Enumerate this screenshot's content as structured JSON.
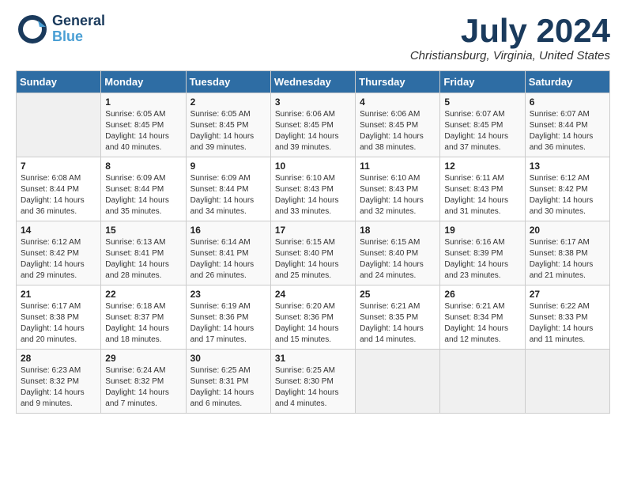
{
  "logo": {
    "line1": "General",
    "line2": "Blue"
  },
  "title": "July 2024",
  "location": "Christiansburg, Virginia, United States",
  "days_header": [
    "Sunday",
    "Monday",
    "Tuesday",
    "Wednesday",
    "Thursday",
    "Friday",
    "Saturday"
  ],
  "weeks": [
    [
      {
        "day": "",
        "sunrise": "",
        "sunset": "",
        "daylight": ""
      },
      {
        "day": "1",
        "sunrise": "Sunrise: 6:05 AM",
        "sunset": "Sunset: 8:45 PM",
        "daylight": "Daylight: 14 hours and 40 minutes."
      },
      {
        "day": "2",
        "sunrise": "Sunrise: 6:05 AM",
        "sunset": "Sunset: 8:45 PM",
        "daylight": "Daylight: 14 hours and 39 minutes."
      },
      {
        "day": "3",
        "sunrise": "Sunrise: 6:06 AM",
        "sunset": "Sunset: 8:45 PM",
        "daylight": "Daylight: 14 hours and 39 minutes."
      },
      {
        "day": "4",
        "sunrise": "Sunrise: 6:06 AM",
        "sunset": "Sunset: 8:45 PM",
        "daylight": "Daylight: 14 hours and 38 minutes."
      },
      {
        "day": "5",
        "sunrise": "Sunrise: 6:07 AM",
        "sunset": "Sunset: 8:45 PM",
        "daylight": "Daylight: 14 hours and 37 minutes."
      },
      {
        "day": "6",
        "sunrise": "Sunrise: 6:07 AM",
        "sunset": "Sunset: 8:44 PM",
        "daylight": "Daylight: 14 hours and 36 minutes."
      }
    ],
    [
      {
        "day": "7",
        "sunrise": "Sunrise: 6:08 AM",
        "sunset": "Sunset: 8:44 PM",
        "daylight": "Daylight: 14 hours and 36 minutes."
      },
      {
        "day": "8",
        "sunrise": "Sunrise: 6:09 AM",
        "sunset": "Sunset: 8:44 PM",
        "daylight": "Daylight: 14 hours and 35 minutes."
      },
      {
        "day": "9",
        "sunrise": "Sunrise: 6:09 AM",
        "sunset": "Sunset: 8:44 PM",
        "daylight": "Daylight: 14 hours and 34 minutes."
      },
      {
        "day": "10",
        "sunrise": "Sunrise: 6:10 AM",
        "sunset": "Sunset: 8:43 PM",
        "daylight": "Daylight: 14 hours and 33 minutes."
      },
      {
        "day": "11",
        "sunrise": "Sunrise: 6:10 AM",
        "sunset": "Sunset: 8:43 PM",
        "daylight": "Daylight: 14 hours and 32 minutes."
      },
      {
        "day": "12",
        "sunrise": "Sunrise: 6:11 AM",
        "sunset": "Sunset: 8:43 PM",
        "daylight": "Daylight: 14 hours and 31 minutes."
      },
      {
        "day": "13",
        "sunrise": "Sunrise: 6:12 AM",
        "sunset": "Sunset: 8:42 PM",
        "daylight": "Daylight: 14 hours and 30 minutes."
      }
    ],
    [
      {
        "day": "14",
        "sunrise": "Sunrise: 6:12 AM",
        "sunset": "Sunset: 8:42 PM",
        "daylight": "Daylight: 14 hours and 29 minutes."
      },
      {
        "day": "15",
        "sunrise": "Sunrise: 6:13 AM",
        "sunset": "Sunset: 8:41 PM",
        "daylight": "Daylight: 14 hours and 28 minutes."
      },
      {
        "day": "16",
        "sunrise": "Sunrise: 6:14 AM",
        "sunset": "Sunset: 8:41 PM",
        "daylight": "Daylight: 14 hours and 26 minutes."
      },
      {
        "day": "17",
        "sunrise": "Sunrise: 6:15 AM",
        "sunset": "Sunset: 8:40 PM",
        "daylight": "Daylight: 14 hours and 25 minutes."
      },
      {
        "day": "18",
        "sunrise": "Sunrise: 6:15 AM",
        "sunset": "Sunset: 8:40 PM",
        "daylight": "Daylight: 14 hours and 24 minutes."
      },
      {
        "day": "19",
        "sunrise": "Sunrise: 6:16 AM",
        "sunset": "Sunset: 8:39 PM",
        "daylight": "Daylight: 14 hours and 23 minutes."
      },
      {
        "day": "20",
        "sunrise": "Sunrise: 6:17 AM",
        "sunset": "Sunset: 8:38 PM",
        "daylight": "Daylight: 14 hours and 21 minutes."
      }
    ],
    [
      {
        "day": "21",
        "sunrise": "Sunrise: 6:17 AM",
        "sunset": "Sunset: 8:38 PM",
        "daylight": "Daylight: 14 hours and 20 minutes."
      },
      {
        "day": "22",
        "sunrise": "Sunrise: 6:18 AM",
        "sunset": "Sunset: 8:37 PM",
        "daylight": "Daylight: 14 hours and 18 minutes."
      },
      {
        "day": "23",
        "sunrise": "Sunrise: 6:19 AM",
        "sunset": "Sunset: 8:36 PM",
        "daylight": "Daylight: 14 hours and 17 minutes."
      },
      {
        "day": "24",
        "sunrise": "Sunrise: 6:20 AM",
        "sunset": "Sunset: 8:36 PM",
        "daylight": "Daylight: 14 hours and 15 minutes."
      },
      {
        "day": "25",
        "sunrise": "Sunrise: 6:21 AM",
        "sunset": "Sunset: 8:35 PM",
        "daylight": "Daylight: 14 hours and 14 minutes."
      },
      {
        "day": "26",
        "sunrise": "Sunrise: 6:21 AM",
        "sunset": "Sunset: 8:34 PM",
        "daylight": "Daylight: 14 hours and 12 minutes."
      },
      {
        "day": "27",
        "sunrise": "Sunrise: 6:22 AM",
        "sunset": "Sunset: 8:33 PM",
        "daylight": "Daylight: 14 hours and 11 minutes."
      }
    ],
    [
      {
        "day": "28",
        "sunrise": "Sunrise: 6:23 AM",
        "sunset": "Sunset: 8:32 PM",
        "daylight": "Daylight: 14 hours and 9 minutes."
      },
      {
        "day": "29",
        "sunrise": "Sunrise: 6:24 AM",
        "sunset": "Sunset: 8:32 PM",
        "daylight": "Daylight: 14 hours and 7 minutes."
      },
      {
        "day": "30",
        "sunrise": "Sunrise: 6:25 AM",
        "sunset": "Sunset: 8:31 PM",
        "daylight": "Daylight: 14 hours and 6 minutes."
      },
      {
        "day": "31",
        "sunrise": "Sunrise: 6:25 AM",
        "sunset": "Sunset: 8:30 PM",
        "daylight": "Daylight: 14 hours and 4 minutes."
      },
      {
        "day": "",
        "sunrise": "",
        "sunset": "",
        "daylight": ""
      },
      {
        "day": "",
        "sunrise": "",
        "sunset": "",
        "daylight": ""
      },
      {
        "day": "",
        "sunrise": "",
        "sunset": "",
        "daylight": ""
      }
    ]
  ]
}
